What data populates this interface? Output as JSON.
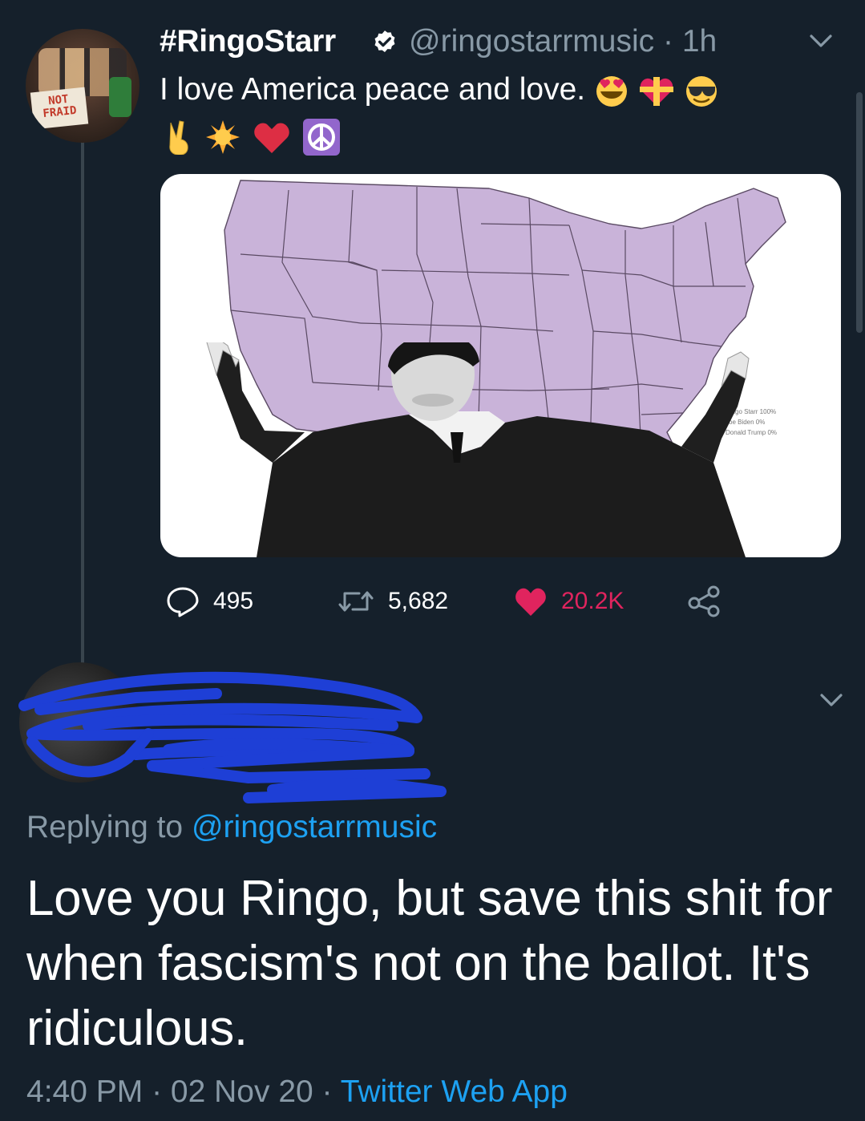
{
  "tweet": {
    "display_name": "#RingoStarr",
    "handle": "@ringostarrmusic",
    "separator": " · ",
    "time_ago": "1h",
    "text": "I love America peace and love.",
    "avatar_sign_text": "NOT FRAID",
    "emoji_line1": [
      "heart-eyes-emoji",
      "gift-heart-emoji",
      "sunglasses-emoji"
    ],
    "emoji_line2": [
      "victory-hand-emoji",
      "sun-emoji",
      "red-heart-emoji",
      "peace-symbol-emoji"
    ],
    "map_legend": [
      {
        "label": "Ringo Starr 100%",
        "color": "#c9b3d9"
      },
      {
        "label": "Joe Biden 0%",
        "color": "#1b2a5e"
      },
      {
        "label": "Donald Trump 0%",
        "color": "#b31b1b"
      }
    ],
    "map_fill_color": "#c9b3d9",
    "actions": {
      "replies": "495",
      "retweets": "5,682",
      "likes": "20.2K"
    },
    "like_color": "#e0245e"
  },
  "reply": {
    "replying_prefix": "Replying to ",
    "replying_handle": "@ringostarrmusic",
    "text": "Love you Ringo, but save this shit for when fascism's not on the ballot. It's ridiculous.",
    "time": "4:40 PM",
    "date": "02 Nov 20",
    "source": "Twitter Web App",
    "redaction_color": "#1e3fd6"
  },
  "theme": {
    "background": "#15202b",
    "secondary_text": "#8899a6",
    "link": "#1da1f2"
  }
}
